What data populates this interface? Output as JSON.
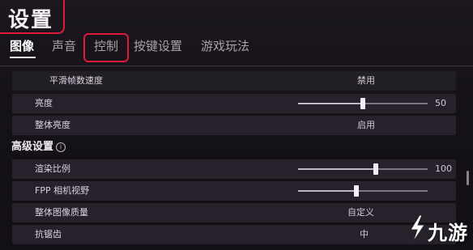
{
  "header": {
    "title": "设置"
  },
  "tabs": [
    {
      "label": "图像",
      "active": true
    },
    {
      "label": "声音",
      "active": false
    },
    {
      "label": "控制",
      "active": false
    },
    {
      "label": "按键设置",
      "active": false
    },
    {
      "label": "游戏玩法",
      "active": false
    }
  ],
  "settings": [
    {
      "label": "平滑帧数速度",
      "value": "禁用"
    },
    {
      "label": "亮度",
      "value": "50",
      "slider_fraction": 0.5
    },
    {
      "label": "整体亮度",
      "value": "启用"
    }
  ],
  "advanced": {
    "heading": "高级设置",
    "info_icon": "info-icon",
    "rows": [
      {
        "label": "渲染比例",
        "value": "100",
        "slider_fraction": 0.6
      },
      {
        "label": "FPP 相机视野",
        "value": "",
        "slider_fraction": 0.45
      },
      {
        "label": "整体图像质量",
        "value": "自定义"
      },
      {
        "label": "抗锯齿",
        "value": "中"
      }
    ]
  },
  "watermark": {
    "text": "九游",
    "icon": "jiuyou-logo-icon"
  },
  "colors": {
    "highlight": "#e0193a",
    "background": "#151217",
    "row": "#26212a"
  }
}
